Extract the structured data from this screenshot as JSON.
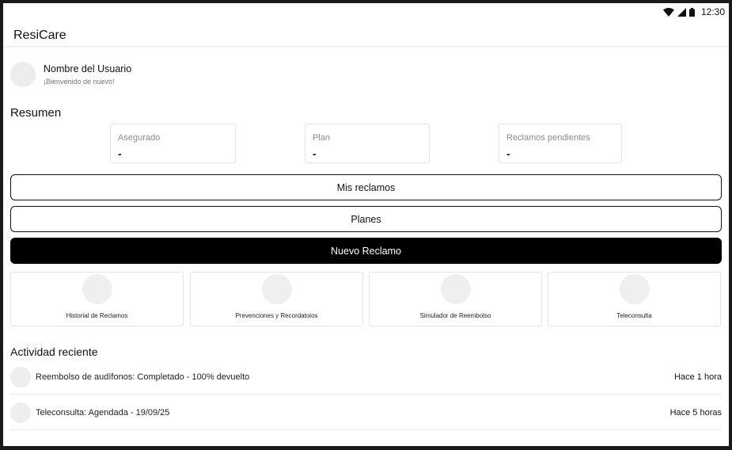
{
  "status_bar": {
    "time": "12:30",
    "icons": [
      "wifi-icon",
      "cell-signal-icon",
      "battery-icon"
    ]
  },
  "app": {
    "title": "ResiCare"
  },
  "user": {
    "name": "Nombre del Usuario",
    "greeting": "¡Bienvenido de nuevo!"
  },
  "summary": {
    "title": "Resumen",
    "cards": [
      {
        "label": "Asegurado",
        "value": "-"
      },
      {
        "label": "Plan",
        "value": "-"
      },
      {
        "label": "Reclamos pendientes",
        "value": "-"
      }
    ]
  },
  "actions": {
    "my_claims": "Mis reclamos",
    "plans": "Planes",
    "new_claim": "Nuevo Reclamo"
  },
  "quick_access": [
    {
      "label": "Historial de Reclamos"
    },
    {
      "label": "Prevenciones y Recordatoios"
    },
    {
      "label": "Simulador de Reembolso"
    },
    {
      "label": "Teleconsulta"
    }
  ],
  "activity": {
    "title": "Actividad reciente",
    "items": [
      {
        "text": "Reembolso de audífonos: Completado - 100% devuelto",
        "time": "Hace 1 hora"
      },
      {
        "text": "Teleconsulta: Agendada - 19/09/25",
        "time": "Hace 5 horas"
      }
    ]
  },
  "colors": {
    "primary_button": "#000000",
    "placeholder_circle": "#EEEEEE",
    "card_border": "#E3E3E3"
  }
}
